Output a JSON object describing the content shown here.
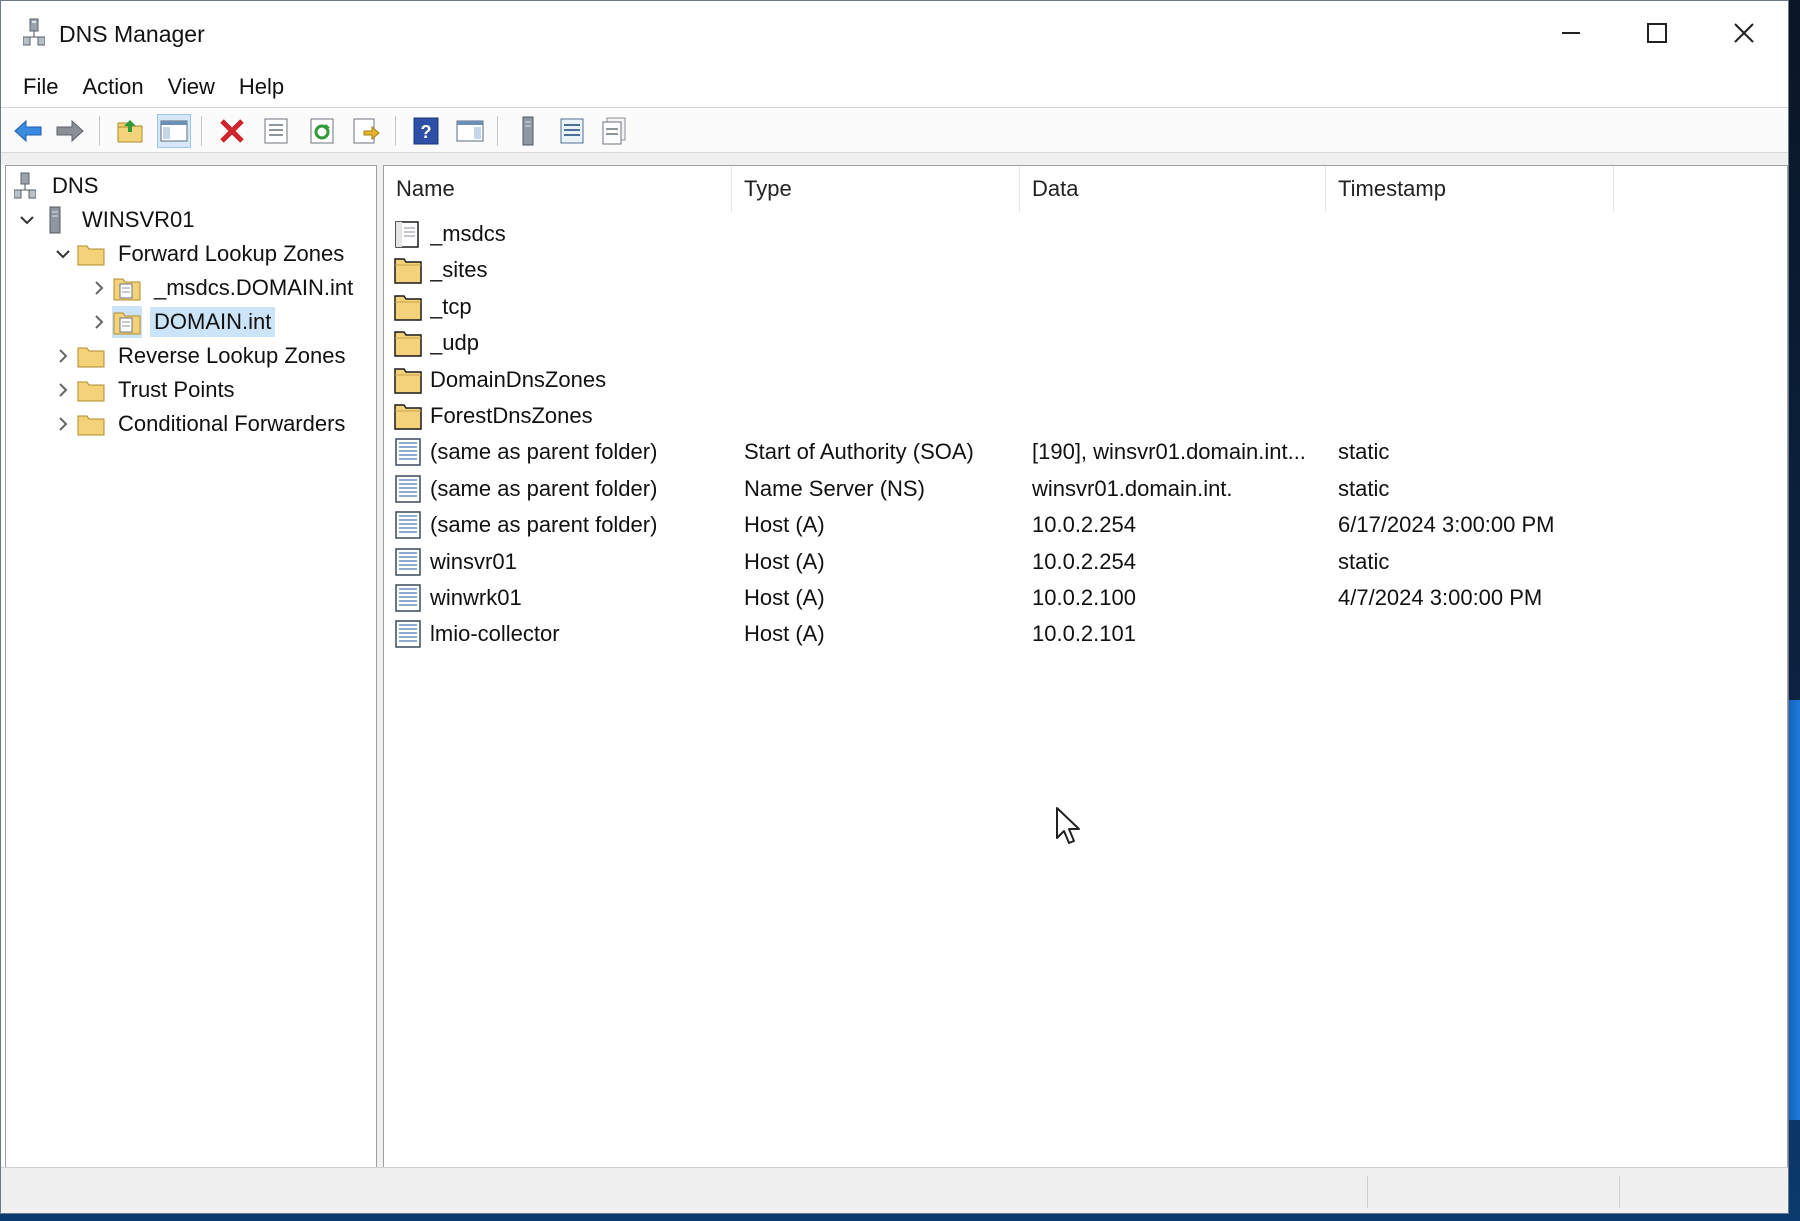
{
  "window": {
    "title": "DNS Manager",
    "controls": {
      "minimize": "minimize",
      "maximize": "maximize",
      "close": "close"
    }
  },
  "menu": [
    "File",
    "Action",
    "View",
    "Help"
  ],
  "toolbar": {
    "buttons": [
      "back",
      "forward",
      "up-one-level",
      "show-hide-console-tree",
      "delete",
      "properties",
      "refresh",
      "export-list",
      "help",
      "show-hide-action-pane",
      "server-action",
      "list-view",
      "detail-view"
    ]
  },
  "tree": {
    "root": "DNS",
    "server": "WINSVR01",
    "forward_zones": "Forward Lookup Zones",
    "zone_msdcs": "_msdcs.DOMAIN.int",
    "zone_domain": "DOMAIN.int",
    "reverse_zones": "Reverse Lookup Zones",
    "trust_points": "Trust Points",
    "conditional_forwarders": "Conditional Forwarders"
  },
  "columns": {
    "name": "Name",
    "type": "Type",
    "data": "Data",
    "timestamp": "Timestamp"
  },
  "records": [
    {
      "name": "_msdcs",
      "type": "",
      "data": "",
      "timestamp": "",
      "icon": "zone-delegation-icon"
    },
    {
      "name": "_sites",
      "type": "",
      "data": "",
      "timestamp": "",
      "icon": "folder-icon"
    },
    {
      "name": "_tcp",
      "type": "",
      "data": "",
      "timestamp": "",
      "icon": "folder-icon"
    },
    {
      "name": "_udp",
      "type": "",
      "data": "",
      "timestamp": "",
      "icon": "folder-icon"
    },
    {
      "name": "DomainDnsZones",
      "type": "",
      "data": "",
      "timestamp": "",
      "icon": "folder-icon"
    },
    {
      "name": "ForestDnsZones",
      "type": "",
      "data": "",
      "timestamp": "",
      "icon": "folder-icon"
    },
    {
      "name": "(same as parent folder)",
      "type": "Start of Authority (SOA)",
      "data": "[190], winsvr01.domain.int...",
      "timestamp": "static",
      "icon": "record-icon"
    },
    {
      "name": "(same as parent folder)",
      "type": "Name Server (NS)",
      "data": "winsvr01.domain.int.",
      "timestamp": "static",
      "icon": "record-icon"
    },
    {
      "name": "(same as parent folder)",
      "type": "Host (A)",
      "data": "10.0.2.254",
      "timestamp": "6/17/2024 3:00:00 PM",
      "icon": "record-icon"
    },
    {
      "name": "winsvr01",
      "type": "Host (A)",
      "data": "10.0.2.254",
      "timestamp": "static",
      "icon": "record-icon"
    },
    {
      "name": "winwrk01",
      "type": "Host (A)",
      "data": "10.0.2.100",
      "timestamp": "4/7/2024 3:00:00 PM",
      "icon": "record-icon"
    },
    {
      "name": "lmio-collector",
      "type": "Host (A)",
      "data": "10.0.2.101",
      "timestamp": "",
      "icon": "record-icon"
    }
  ],
  "colors": {
    "selection": "#cce4f7",
    "folder": "#f3d27a",
    "accent": "#2a6fc9"
  }
}
